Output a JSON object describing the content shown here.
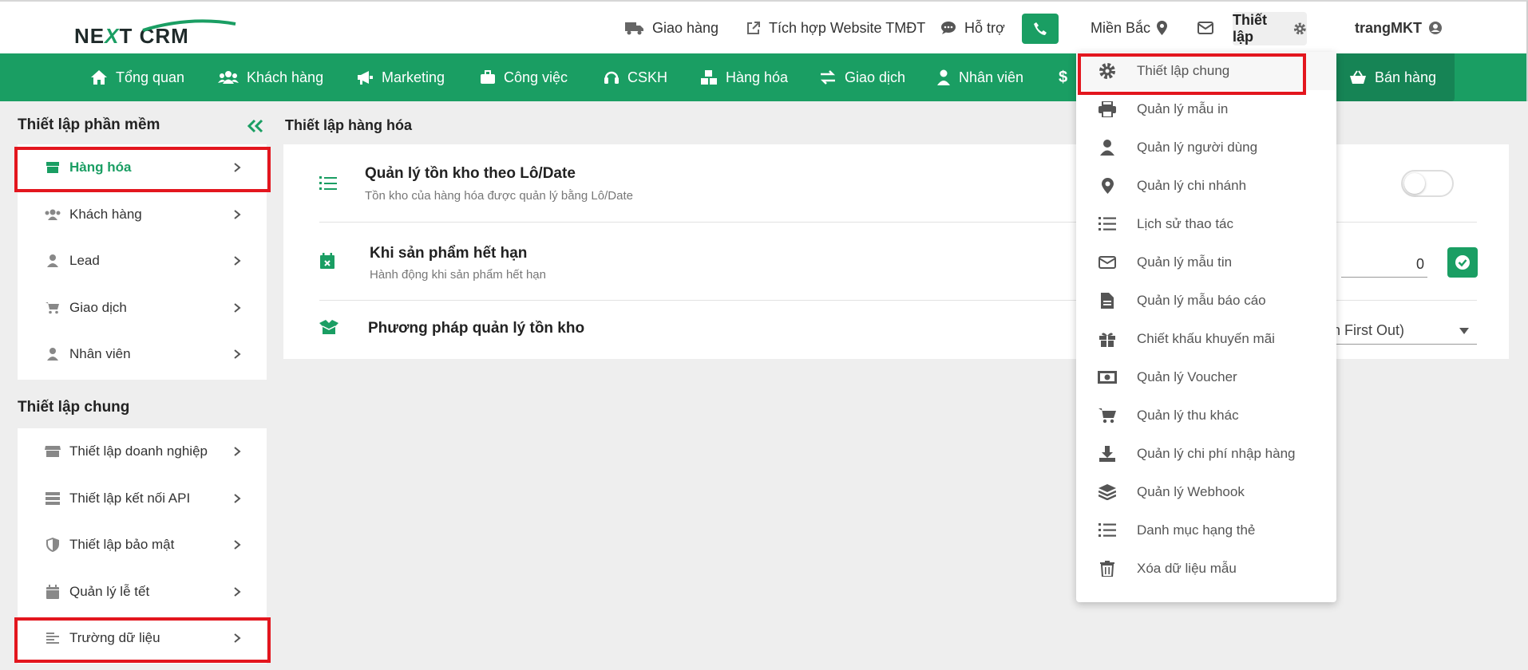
{
  "app": {
    "logo_text_1": "NE",
    "logo_text_x": "X",
    "logo_text_2": "T CRM"
  },
  "topnav": {
    "delivery": "Giao hàng",
    "website": "Tích hợp Website TMĐT",
    "support": "Hỗ trợ",
    "region": "Miền Bắc",
    "setup": "Thiết lập",
    "user": "trangMKT"
  },
  "mainnav": {
    "items": [
      "Tổng quan",
      "Khách hàng",
      "Marketing",
      "Công việc",
      "CSKH",
      "Hàng hóa",
      "Giao dịch",
      "Nhân viên"
    ],
    "sell": "Bán hàng"
  },
  "sidebar": {
    "software_title": "Thiết lập phần mềm",
    "software_items": [
      "Hàng hóa",
      "Khách hàng",
      "Lead",
      "Giao dịch",
      "Nhân viên"
    ],
    "general_title": "Thiết lập chung",
    "general_items": [
      "Thiết lập doanh nghiệp",
      "Thiết lập kết nối API",
      "Thiết lập bảo mật",
      "Quản lý lễ tết",
      "Trường dữ liệu"
    ]
  },
  "content": {
    "title": "Thiết lập hàng hóa",
    "rows": [
      {
        "title": "Quản lý tồn kho theo Lô/Date",
        "desc": "Tồn kho của hàng hóa được quản lý bằng Lô/Date"
      },
      {
        "title": "Khi sản phẩm hết hạn",
        "desc": "Hành động khi sản phẩm hết hạn"
      },
      {
        "title": "Phương pháp quản lý tồn kho",
        "desc": ""
      }
    ],
    "expiry_value": "0",
    "method_value": "t In First Out)"
  },
  "dropdown": {
    "items": [
      {
        "label": "Thiết lập chung",
        "icon": "gear-icon"
      },
      {
        "label": "Quản lý mẫu in",
        "icon": "printer-icon"
      },
      {
        "label": "Quản lý người dùng",
        "icon": "user-icon"
      },
      {
        "label": "Quản lý chi nhánh",
        "icon": "map-pin-icon"
      },
      {
        "label": "Lịch sử thao tác",
        "icon": "list-icon"
      },
      {
        "label": "Quản lý mẫu tin",
        "icon": "envelope-icon"
      },
      {
        "label": "Quản lý mẫu báo cáo",
        "icon": "file-icon"
      },
      {
        "label": "Chiết khấu khuyến mãi",
        "icon": "gift-icon"
      },
      {
        "label": "Quản lý Voucher",
        "icon": "money-bill-icon"
      },
      {
        "label": "Quản lý thu khác",
        "icon": "cart-icon"
      },
      {
        "label": "Quản lý chi phí nhập hàng",
        "icon": "download-icon"
      },
      {
        "label": "Quản lý Webhook",
        "icon": "layers-icon"
      },
      {
        "label": "Danh mục hạng thẻ",
        "icon": "list-icon"
      },
      {
        "label": "Xóa dữ liệu mẫu",
        "icon": "trash-icon"
      }
    ]
  },
  "colors": {
    "brand_green": "#1a9e63",
    "highlight_red": "#e3161e"
  }
}
